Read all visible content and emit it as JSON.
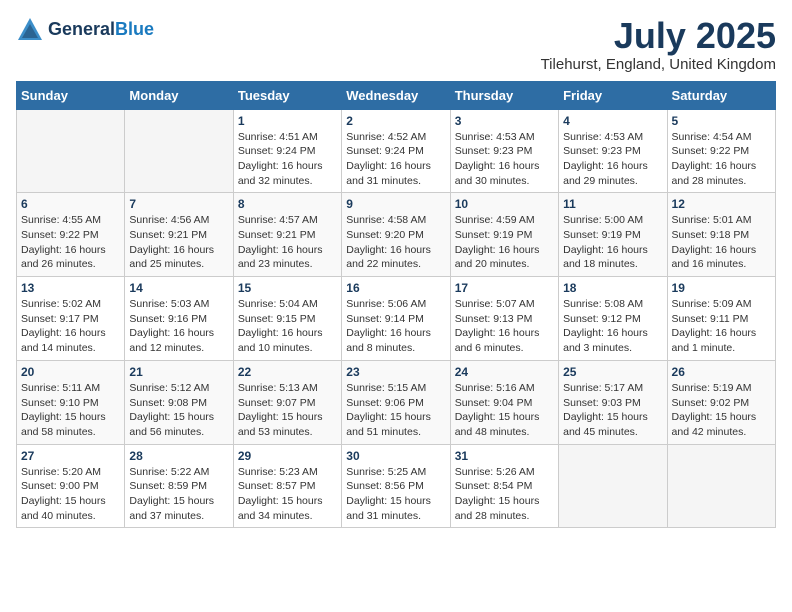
{
  "header": {
    "logo_general": "General",
    "logo_blue": "Blue",
    "month_title": "July 2025",
    "location": "Tilehurst, England, United Kingdom"
  },
  "days_of_week": [
    "Sunday",
    "Monday",
    "Tuesday",
    "Wednesday",
    "Thursday",
    "Friday",
    "Saturday"
  ],
  "weeks": [
    [
      {
        "day": "",
        "info": ""
      },
      {
        "day": "",
        "info": ""
      },
      {
        "day": "1",
        "info": "Sunrise: 4:51 AM\nSunset: 9:24 PM\nDaylight: 16 hours and 32 minutes."
      },
      {
        "day": "2",
        "info": "Sunrise: 4:52 AM\nSunset: 9:24 PM\nDaylight: 16 hours and 31 minutes."
      },
      {
        "day": "3",
        "info": "Sunrise: 4:53 AM\nSunset: 9:23 PM\nDaylight: 16 hours and 30 minutes."
      },
      {
        "day": "4",
        "info": "Sunrise: 4:53 AM\nSunset: 9:23 PM\nDaylight: 16 hours and 29 minutes."
      },
      {
        "day": "5",
        "info": "Sunrise: 4:54 AM\nSunset: 9:22 PM\nDaylight: 16 hours and 28 minutes."
      }
    ],
    [
      {
        "day": "6",
        "info": "Sunrise: 4:55 AM\nSunset: 9:22 PM\nDaylight: 16 hours and 26 minutes."
      },
      {
        "day": "7",
        "info": "Sunrise: 4:56 AM\nSunset: 9:21 PM\nDaylight: 16 hours and 25 minutes."
      },
      {
        "day": "8",
        "info": "Sunrise: 4:57 AM\nSunset: 9:21 PM\nDaylight: 16 hours and 23 minutes."
      },
      {
        "day": "9",
        "info": "Sunrise: 4:58 AM\nSunset: 9:20 PM\nDaylight: 16 hours and 22 minutes."
      },
      {
        "day": "10",
        "info": "Sunrise: 4:59 AM\nSunset: 9:19 PM\nDaylight: 16 hours and 20 minutes."
      },
      {
        "day": "11",
        "info": "Sunrise: 5:00 AM\nSunset: 9:19 PM\nDaylight: 16 hours and 18 minutes."
      },
      {
        "day": "12",
        "info": "Sunrise: 5:01 AM\nSunset: 9:18 PM\nDaylight: 16 hours and 16 minutes."
      }
    ],
    [
      {
        "day": "13",
        "info": "Sunrise: 5:02 AM\nSunset: 9:17 PM\nDaylight: 16 hours and 14 minutes."
      },
      {
        "day": "14",
        "info": "Sunrise: 5:03 AM\nSunset: 9:16 PM\nDaylight: 16 hours and 12 minutes."
      },
      {
        "day": "15",
        "info": "Sunrise: 5:04 AM\nSunset: 9:15 PM\nDaylight: 16 hours and 10 minutes."
      },
      {
        "day": "16",
        "info": "Sunrise: 5:06 AM\nSunset: 9:14 PM\nDaylight: 16 hours and 8 minutes."
      },
      {
        "day": "17",
        "info": "Sunrise: 5:07 AM\nSunset: 9:13 PM\nDaylight: 16 hours and 6 minutes."
      },
      {
        "day": "18",
        "info": "Sunrise: 5:08 AM\nSunset: 9:12 PM\nDaylight: 16 hours and 3 minutes."
      },
      {
        "day": "19",
        "info": "Sunrise: 5:09 AM\nSunset: 9:11 PM\nDaylight: 16 hours and 1 minute."
      }
    ],
    [
      {
        "day": "20",
        "info": "Sunrise: 5:11 AM\nSunset: 9:10 PM\nDaylight: 15 hours and 58 minutes."
      },
      {
        "day": "21",
        "info": "Sunrise: 5:12 AM\nSunset: 9:08 PM\nDaylight: 15 hours and 56 minutes."
      },
      {
        "day": "22",
        "info": "Sunrise: 5:13 AM\nSunset: 9:07 PM\nDaylight: 15 hours and 53 minutes."
      },
      {
        "day": "23",
        "info": "Sunrise: 5:15 AM\nSunset: 9:06 PM\nDaylight: 15 hours and 51 minutes."
      },
      {
        "day": "24",
        "info": "Sunrise: 5:16 AM\nSunset: 9:04 PM\nDaylight: 15 hours and 48 minutes."
      },
      {
        "day": "25",
        "info": "Sunrise: 5:17 AM\nSunset: 9:03 PM\nDaylight: 15 hours and 45 minutes."
      },
      {
        "day": "26",
        "info": "Sunrise: 5:19 AM\nSunset: 9:02 PM\nDaylight: 15 hours and 42 minutes."
      }
    ],
    [
      {
        "day": "27",
        "info": "Sunrise: 5:20 AM\nSunset: 9:00 PM\nDaylight: 15 hours and 40 minutes."
      },
      {
        "day": "28",
        "info": "Sunrise: 5:22 AM\nSunset: 8:59 PM\nDaylight: 15 hours and 37 minutes."
      },
      {
        "day": "29",
        "info": "Sunrise: 5:23 AM\nSunset: 8:57 PM\nDaylight: 15 hours and 34 minutes."
      },
      {
        "day": "30",
        "info": "Sunrise: 5:25 AM\nSunset: 8:56 PM\nDaylight: 15 hours and 31 minutes."
      },
      {
        "day": "31",
        "info": "Sunrise: 5:26 AM\nSunset: 8:54 PM\nDaylight: 15 hours and 28 minutes."
      },
      {
        "day": "",
        "info": ""
      },
      {
        "day": "",
        "info": ""
      }
    ]
  ]
}
